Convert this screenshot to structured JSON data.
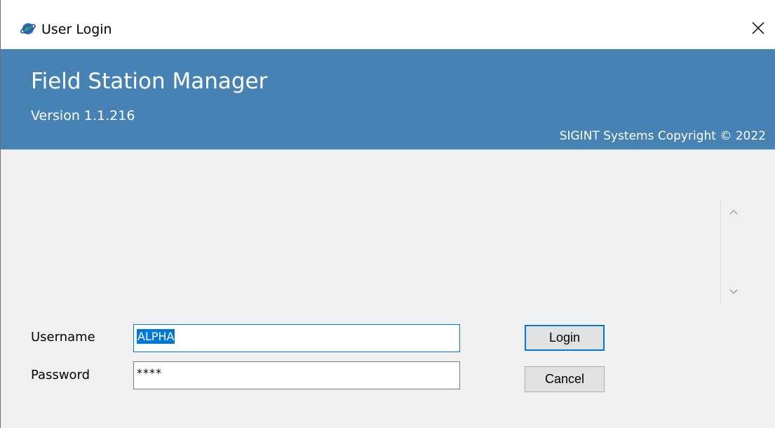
{
  "window": {
    "title": "User Login",
    "icon": "globe-icon",
    "close_icon": "close-icon"
  },
  "banner": {
    "title": "Field Station Manager",
    "version": "Version 1.1.216",
    "copyright": "SIGINT Systems Copyright © 2022",
    "background_color": "#4682b4"
  },
  "scrollbar": {
    "up_icon": "chevron-up-icon",
    "down_icon": "chevron-down-icon"
  },
  "form": {
    "username_label": "Username",
    "username_value": "ALPHA",
    "password_label": "Password",
    "password_value": "****"
  },
  "buttons": {
    "login_label": "Login",
    "cancel_label": "Cancel"
  },
  "colors": {
    "accent": "#0078d7",
    "button_face": "#e1e1e1",
    "dialog_background": "#f0f0f0"
  }
}
